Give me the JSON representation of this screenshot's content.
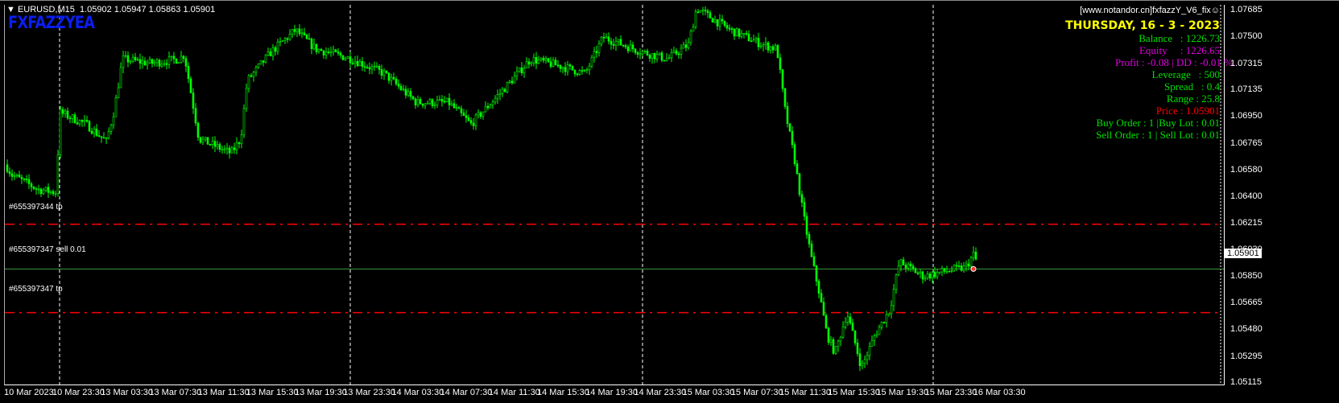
{
  "header": {
    "symbol": "EURUSD,M15",
    "ohlc": "1.05902 1.05947 1.05863 1.05901"
  },
  "logo": "FXFAZZYEA",
  "panel": {
    "site": "[www.notandor.cn]fxfazzY_V6_fix☺",
    "date": "THURSDAY, 16 - 3 - 2023",
    "balance": "Balance   : 1226.73",
    "equity": "Equity     : 1226.65",
    "profit": "Profit : -0.08 | DD : -0.01 %",
    "leverage": "Leverage   : 500",
    "spread": "Spread   : 0.4",
    "range": "Range : 25.8",
    "price": "Price : 1.05901",
    "buy": "Buy Order : 1 |Buy Lot : 0.01",
    "sell": "Sell Order : 1 | Sell Lot : 0.01"
  },
  "colors": {
    "green": "#00e000",
    "magenta": "#e000e0",
    "yellow": "#ffff00",
    "red": "#ff0000",
    "candle": "#00ff00"
  },
  "orders": {
    "tp_upper": "#655397344 tp",
    "entry": "#655397347 sell 0.01",
    "tp_lower": "#655397347 tp"
  },
  "current_price": "1.05901",
  "chart_data": {
    "type": "candlestick",
    "price_ticks": [
      "1.07685",
      "1.07500",
      "1.07315",
      "1.07135",
      "1.06950",
      "1.06765",
      "1.06580",
      "1.06400",
      "1.06215",
      "1.06030",
      "1.05850",
      "1.05665",
      "1.05480",
      "1.05295",
      "1.05115"
    ],
    "ylim": [
      1.05115,
      1.07685
    ],
    "time_labels": [
      "10 Mar 2023",
      "10 Mar 23:30",
      "13 Mar 03:30",
      "13 Mar 07:30",
      "13 Mar 11:30",
      "13 Mar 15:30",
      "13 Mar 19:30",
      "13 Mar 23:30",
      "14 Mar 03:30",
      "14 Mar 07:30",
      "14 Mar 11:30",
      "14 Mar 15:30",
      "14 Mar 19:30",
      "14 Mar 23:30",
      "15 Mar 03:30",
      "15 Mar 07:30",
      "15 Mar 11:30",
      "15 Mar 15:30",
      "15 Mar 19:30",
      "15 Mar 23:30",
      "16 Mar 03:30"
    ],
    "levels": {
      "tp_upper": 1.0621,
      "entry": 1.05901,
      "tp_lower": 1.056
    },
    "price_path": [
      [
        0,
        1.0662
      ],
      [
        8,
        1.0655
      ],
      [
        40,
        1.0645
      ],
      [
        62,
        1.0643
      ],
      [
        68,
        1.0698
      ],
      [
        100,
        1.069
      ],
      [
        125,
        1.0678
      ],
      [
        135,
        1.07
      ],
      [
        145,
        1.0735
      ],
      [
        180,
        1.0732
      ],
      [
        215,
        1.0735
      ],
      [
        222,
        1.0738
      ],
      [
        240,
        1.068
      ],
      [
        280,
        1.067
      ],
      [
        292,
        1.068
      ],
      [
        300,
        1.072
      ],
      [
        330,
        1.074
      ],
      [
        360,
        1.0755
      ],
      [
        385,
        1.0742
      ],
      [
        430,
        1.0735
      ],
      [
        470,
        1.0725
      ],
      [
        510,
        1.0705
      ],
      [
        550,
        1.0705
      ],
      [
        578,
        1.069
      ],
      [
        620,
        1.0715
      ],
      [
        652,
        1.0735
      ],
      [
        690,
        1.073
      ],
      [
        720,
        1.0725
      ],
      [
        742,
        1.075
      ],
      [
        790,
        1.074
      ],
      [
        822,
        1.0735
      ],
      [
        848,
        1.0745
      ],
      [
        858,
        1.077
      ],
      [
        900,
        1.0755
      ],
      [
        940,
        1.0745
      ],
      [
        958,
        1.0742
      ],
      [
        968,
        1.07
      ],
      [
        980,
        1.0665
      ],
      [
        990,
        1.063
      ],
      [
        1000,
        1.06
      ],
      [
        1010,
        1.0575
      ],
      [
        1020,
        1.0545
      ],
      [
        1030,
        1.0532
      ],
      [
        1045,
        1.056
      ],
      [
        1063,
        1.0522
      ],
      [
        1080,
        1.0545
      ],
      [
        1098,
        1.0562
      ],
      [
        1110,
        1.0595
      ],
      [
        1140,
        1.0585
      ],
      [
        1170,
        1.0589
      ],
      [
        1192,
        1.0591
      ],
      [
        1202,
        1.06
      ],
      [
        1210,
        1.059
      ]
    ]
  }
}
